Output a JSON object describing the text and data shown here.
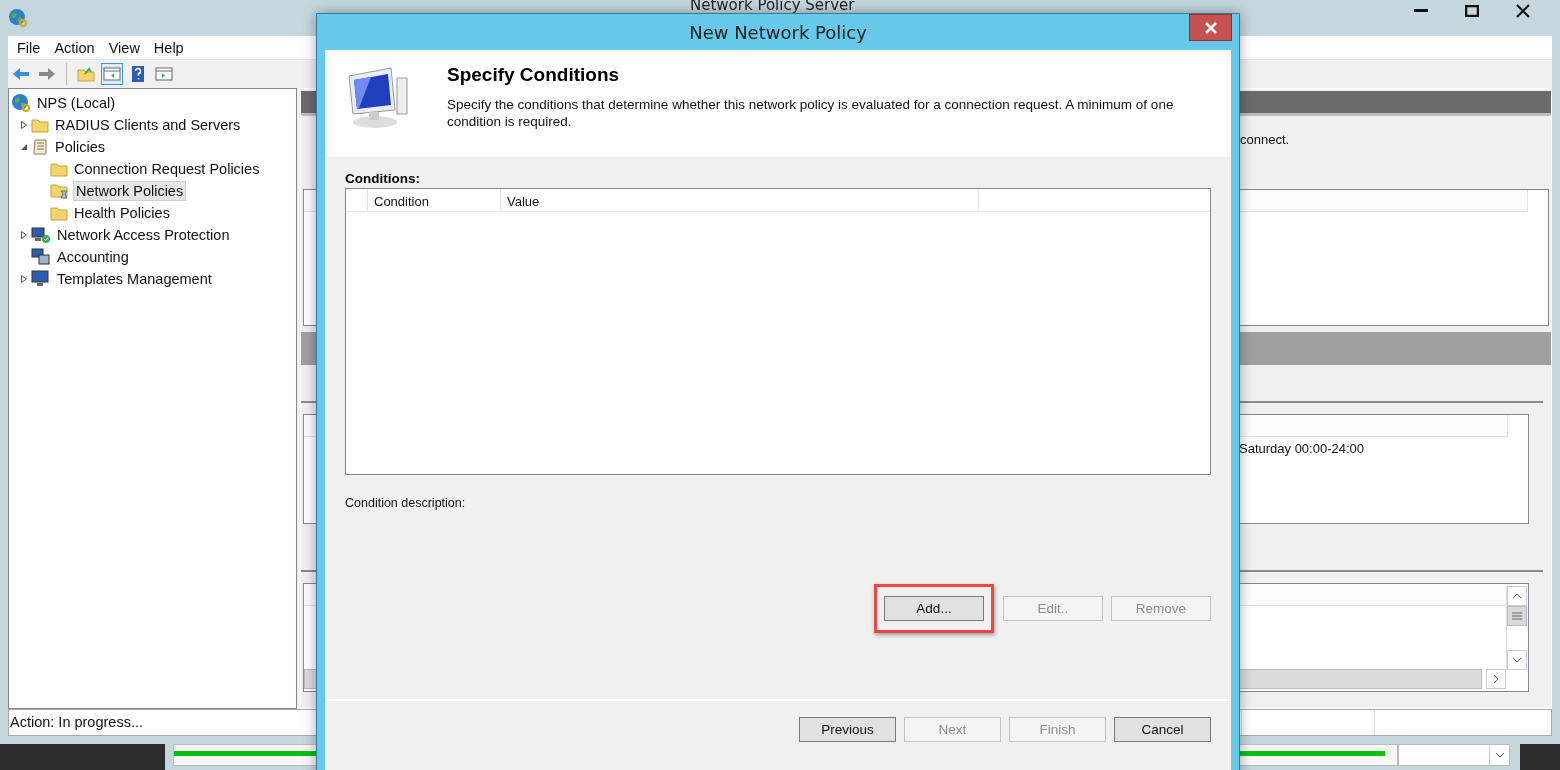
{
  "main_window": {
    "title": "Network Policy Server",
    "menu": [
      "File",
      "Action",
      "View",
      "Help"
    ],
    "toolbar": [
      {
        "kind": "back",
        "pressed": false
      },
      {
        "kind": "forward",
        "pressed": false
      },
      {
        "kind": "up",
        "pressed": false
      },
      {
        "kind": "tree",
        "pressed": true
      },
      {
        "kind": "help",
        "pressed": false
      },
      {
        "kind": "pane",
        "pressed": false
      }
    ],
    "tree": [
      {
        "label": "NPS (Local)",
        "kind": "globe",
        "selected": false,
        "children": [
          {
            "label": "RADIUS Clients and Servers",
            "kind": "folder",
            "selected": false,
            "expanded": false
          },
          {
            "label": "Policies",
            "kind": "scroll",
            "selected": false,
            "expanded": true,
            "children": [
              {
                "label": "Connection Request Policies",
                "kind": "folder",
                "selected": false
              },
              {
                "label": "Network Policies",
                "kind": "policy-folder",
                "selected": true
              },
              {
                "label": "Health Policies",
                "kind": "folder",
                "selected": false
              }
            ]
          },
          {
            "label": "Network Access Protection",
            "kind": "shield-computer",
            "selected": false,
            "expanded": false
          },
          {
            "label": "Accounting",
            "kind": "computers",
            "selected": false
          },
          {
            "label": "Templates Management",
            "kind": "monitor",
            "selected": false,
            "expanded": false
          }
        ]
      }
    ],
    "right_pane": {
      "note": "connect.",
      "schedule": "Saturday 00:00-24:00"
    },
    "status_bar": "Action:  In progress..."
  },
  "taskbar": {
    "progress": {
      "level": 0.99
    }
  },
  "dialog": {
    "title": "New Network Policy",
    "heading": "Specify Conditions",
    "description": "Specify the conditions that determine whether this network policy is evaluated for a connection request. A minimum of one condition is required.",
    "conditions": {
      "label": "Conditions:",
      "columns": [
        "Condition",
        "Value"
      ]
    },
    "description_label": "Condition description:",
    "buttons": [
      {
        "label": "Add...",
        "disabled": false,
        "highlighted": true
      },
      {
        "label": "Edit..",
        "disabled": true,
        "highlighted": false
      },
      {
        "label": "Remove",
        "disabled": true,
        "highlighted": false
      }
    ],
    "footer_buttons": [
      {
        "label": "Previous",
        "disabled": false
      },
      {
        "label": "Next",
        "disabled": true
      },
      {
        "label": "Finish",
        "disabled": true
      },
      {
        "label": "Cancel",
        "disabled": false
      }
    ]
  }
}
